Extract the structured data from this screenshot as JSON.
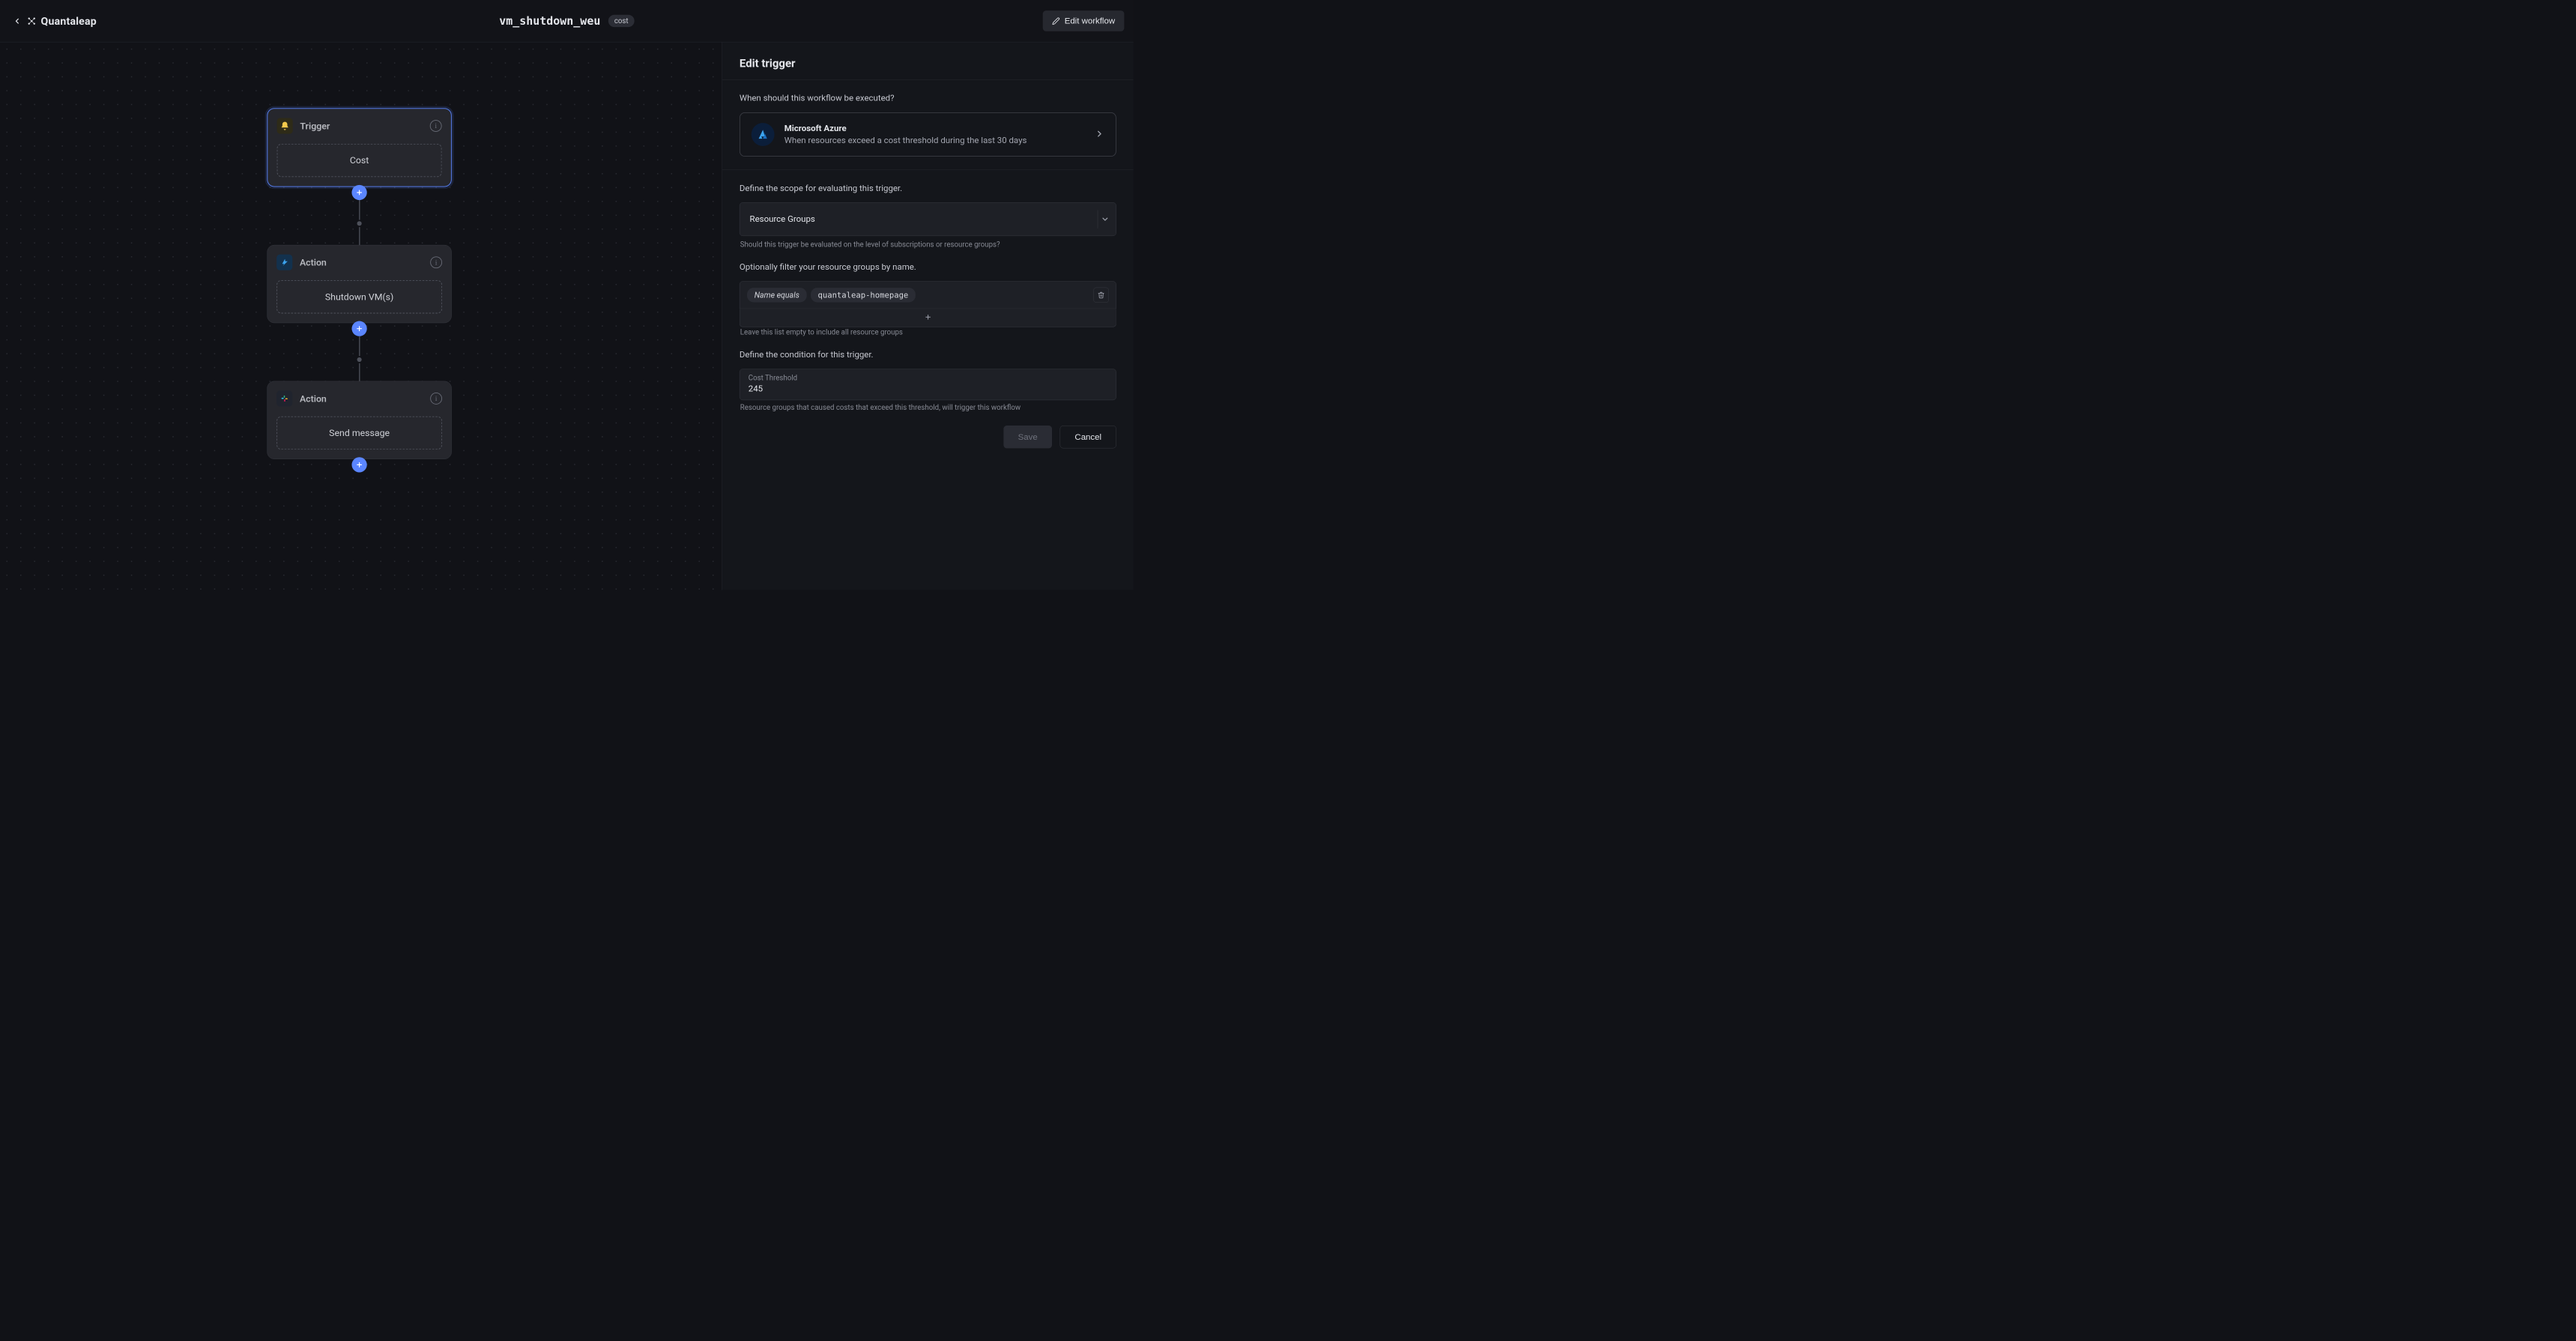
{
  "header": {
    "brand": "Quantaleap",
    "workflow_title": "vm_shutdown_weu",
    "badge": "cost",
    "edit_button": "Edit workflow"
  },
  "flow": {
    "trigger": {
      "label": "Trigger",
      "body": "Cost"
    },
    "action1": {
      "label": "Action",
      "body": "Shutdown VM(s)"
    },
    "action2": {
      "label": "Action",
      "body": "Send message"
    }
  },
  "panel": {
    "title": "Edit trigger",
    "section1_label": "When should this workflow be executed?",
    "provider": {
      "name": "Microsoft Azure",
      "desc": "When resources exceed a cost threshold during the last 30 days"
    },
    "scope_label": "Define the scope for evaluating this trigger.",
    "scope_select": "Resource Groups",
    "scope_helper": "Should this trigger be evaluated on the level of subscriptions or resource groups?",
    "filter_label": "Optionally filter your resource groups by name.",
    "filter_chip_predicate": "Name equals",
    "filter_chip_value": "quantaleap-homepage",
    "filter_helper": "Leave this list empty to include all resource groups",
    "condition_label": "Define the condition for this trigger.",
    "cost_field_label": "Cost Threshold",
    "cost_field_value": "245",
    "cost_helper": "Resource groups that caused costs that exceed this threshold, will trigger this workflow",
    "save_label": "Save",
    "cancel_label": "Cancel"
  }
}
